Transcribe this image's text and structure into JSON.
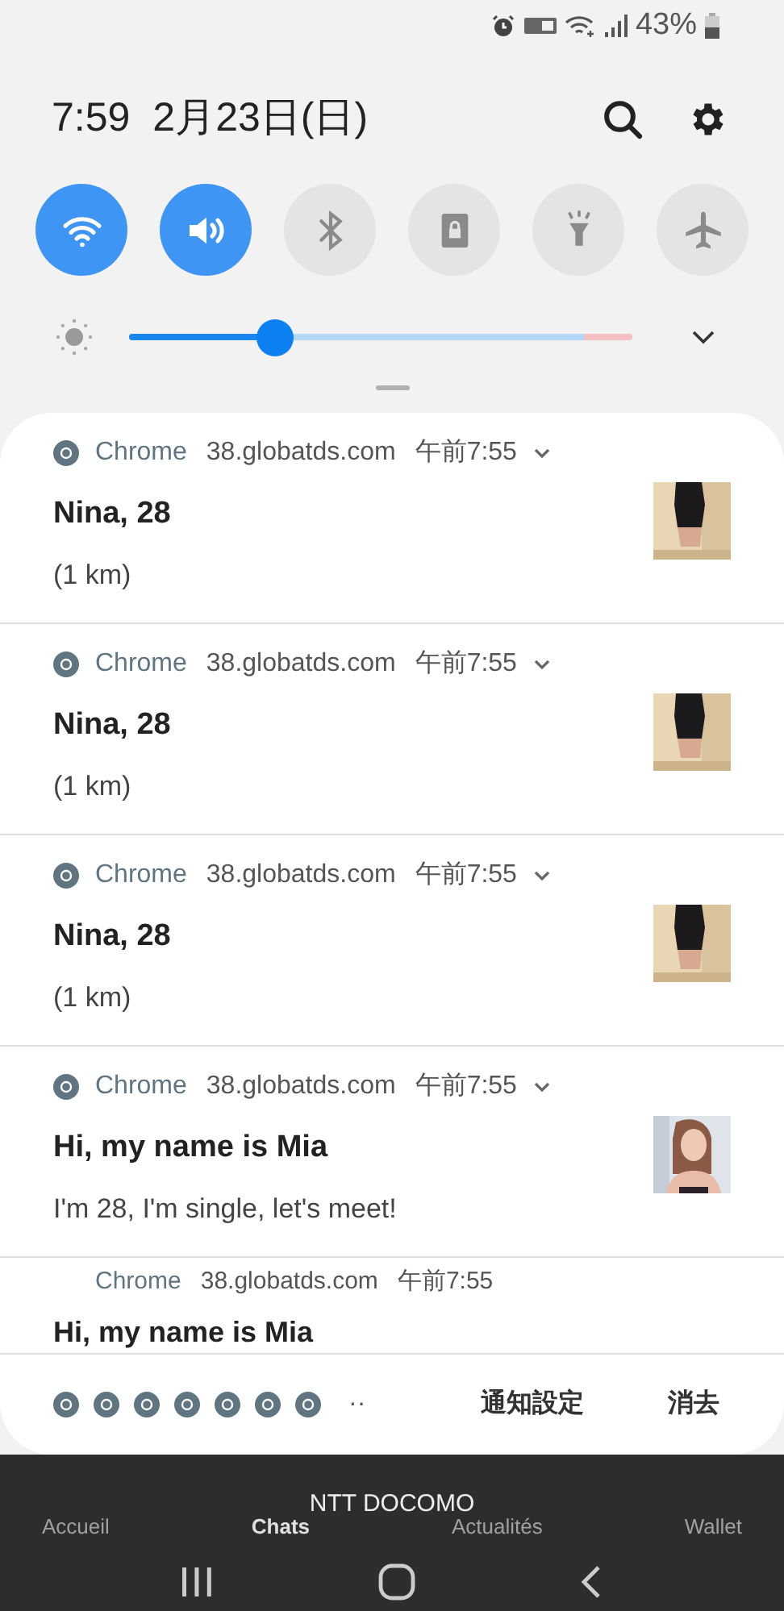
{
  "status_bar": {
    "battery": "43%"
  },
  "header": {
    "time": "7:59",
    "date": "2月23日(日)"
  },
  "quick_toggles": [
    {
      "kind": "wifi",
      "on": true
    },
    {
      "kind": "sound",
      "on": true
    },
    {
      "kind": "bluetooth",
      "on": false
    },
    {
      "kind": "lock",
      "on": false
    },
    {
      "kind": "flashlight",
      "on": false
    },
    {
      "kind": "airplane",
      "on": false
    }
  ],
  "brightness": {
    "level": 0.29
  },
  "notifications": [
    {
      "app": "Chrome",
      "site": "38.globatds.com",
      "time": "午前7:55",
      "title": "Nina, 28",
      "body": "(1 km)"
    },
    {
      "app": "Chrome",
      "site": "38.globatds.com",
      "time": "午前7:55",
      "title": "Nina, 28",
      "body": "(1 km)"
    },
    {
      "app": "Chrome",
      "site": "38.globatds.com",
      "time": "午前7:55",
      "title": "Nina, 28",
      "body": "(1 km)"
    },
    {
      "app": "Chrome",
      "site": "38.globatds.com",
      "time": "午前7:55",
      "title": "Hi, my name is Mia",
      "body": "I'm 28, I'm single, let's meet!"
    },
    {
      "app": "Chrome",
      "site": "38.globatds.com",
      "time": "午前7:55",
      "title": "Hi, my name is Mia"
    }
  ],
  "footer": {
    "icon_count_more": "··",
    "settings": "通知設定",
    "clear": "消去"
  },
  "background_app_tabs": [
    {
      "label": "Accueil",
      "selected": false
    },
    {
      "label": "Chats",
      "selected": true
    },
    {
      "label": "Actualités",
      "selected": false
    },
    {
      "label": "Wallet",
      "selected": false
    }
  ],
  "carrier": "NTT DOCOMO"
}
